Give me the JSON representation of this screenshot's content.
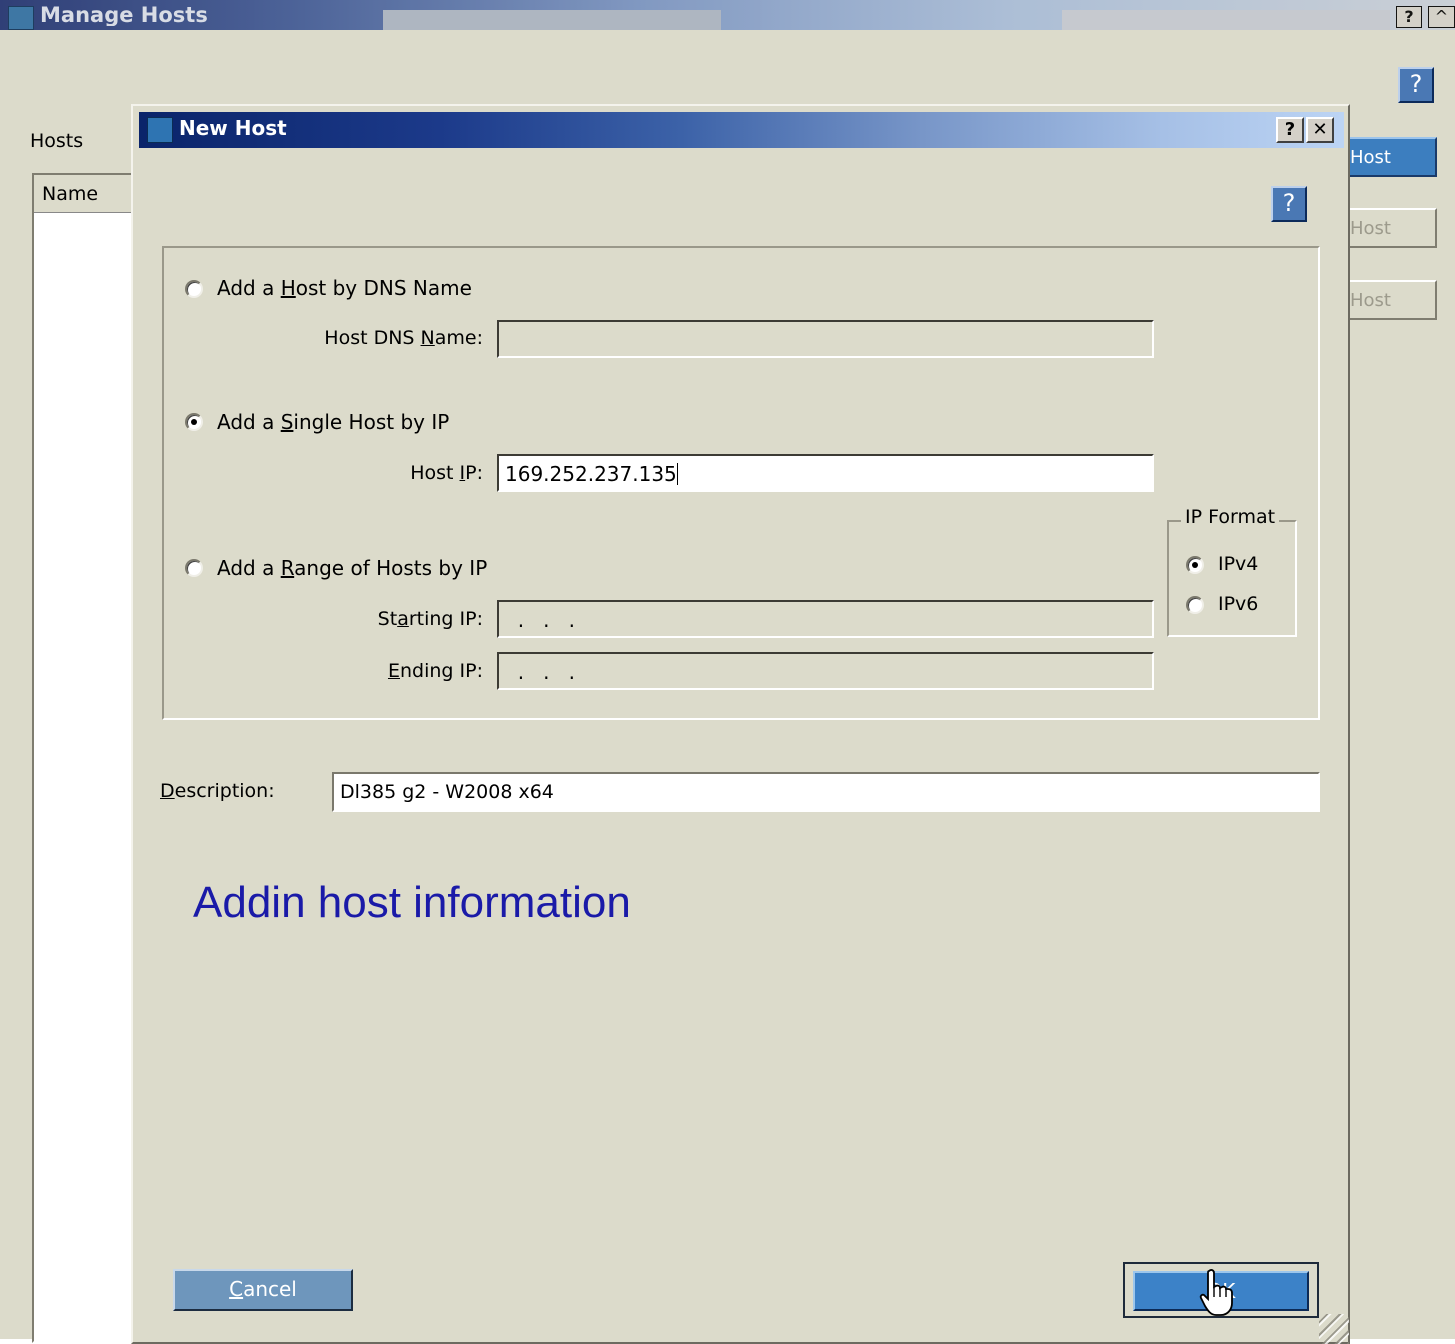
{
  "background_window": {
    "title": "Manage Hosts",
    "help_caption": "?",
    "hosts_label": "Hosts",
    "list_header": "Name",
    "buttons": [
      {
        "label": "Host"
      },
      {
        "label": "Host"
      },
      {
        "label": "Host"
      }
    ]
  },
  "dialog": {
    "title": "New Host",
    "caption_help": "?",
    "caption_close": "✕",
    "help": "?",
    "options": {
      "dns": {
        "pre": "Add a ",
        "mnemonic": "H",
        "post": "ost by DNS Name",
        "selected": false
      },
      "single": {
        "pre": "Add a ",
        "mnemonic": "S",
        "post": "ingle Host by IP",
        "selected": true
      },
      "range": {
        "pre": "Add a ",
        "mnemonic": "R",
        "post": "ange of Hosts by IP",
        "selected": false
      }
    },
    "fields": {
      "dns_name": {
        "pre": "Host DNS ",
        "mnemonic": "N",
        "post": "ame:",
        "value": ""
      },
      "host_ip": {
        "pre": "Host ",
        "mnemonic": "I",
        "post": "P:",
        "value": "169.252.237.135"
      },
      "starting_ip": {
        "pre": "St",
        "mnemonic": "a",
        "post": "rting IP:",
        "value": "  .   .   ."
      },
      "ending_ip": {
        "pre": "",
        "mnemonic": "E",
        "post": "nding IP:",
        "value": "  .   .   ."
      }
    },
    "ip_format": {
      "legend": "IP Format",
      "ipv4": {
        "label": "IPv4",
        "selected": true
      },
      "ipv6": {
        "label": "IPv6",
        "selected": false
      }
    },
    "description": {
      "label_mnemonic": "D",
      "label_rest": "escription:",
      "value": "Dl385 g2 - W2008 x64"
    },
    "annotation": "Addin host information",
    "cancel": {
      "mnemonic": "C",
      "rest": "ancel"
    },
    "ok": {
      "label": "OK"
    }
  }
}
